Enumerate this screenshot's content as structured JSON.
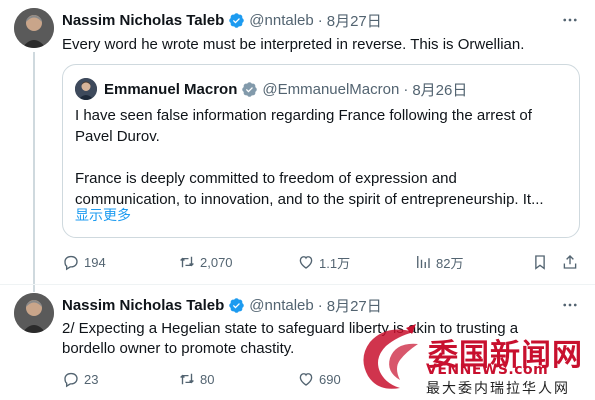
{
  "colors": {
    "verified_badge": "#1d9bf0",
    "link": "#1d9bf0",
    "muted": "#536471",
    "border": "#cfd9de",
    "watermark_red": "#c8102e"
  },
  "tweets": [
    {
      "author_name": "Nassim Nicholas Taleb",
      "handle": "@nntaleb",
      "separator": "·",
      "time": "8月27日",
      "text": "Every word he wrote must be interpreted in reverse. This is Orwellian.",
      "quoted": {
        "author_name": "Emmanuel Macron",
        "handle": "@EmmanuelMacron",
        "separator": "·",
        "time": "8月26日",
        "paragraph_1_line_1": "I have seen false information regarding France following the arrest of",
        "paragraph_1_line_2": "Pavel Durov.",
        "paragraph_2_line_1": "France is deeply committed to freedom of expression and",
        "paragraph_2_line_2": "communication, to innovation, and to the spirit of entrepreneurship. It...",
        "show_more": "显示更多"
      },
      "actions": {
        "replies": "194",
        "reposts": "2,070",
        "likes": "1.1万",
        "views": "82万"
      }
    },
    {
      "author_name": "Nassim Nicholas Taleb",
      "handle": "@nntaleb",
      "separator": "·",
      "time": "8月27日",
      "text_line_1": "2/ Expecting a Hegelian state to safeguard liberty is akin to trusting a",
      "text_line_2": "bordello owner to promote chastity.",
      "actions": {
        "replies": "23",
        "reposts": "80",
        "likes": "690"
      }
    }
  ],
  "watermark": {
    "title": "委国新闻网",
    "domain": "VENNEWS.com",
    "subtitle": "最大委内瑞拉华人网"
  }
}
